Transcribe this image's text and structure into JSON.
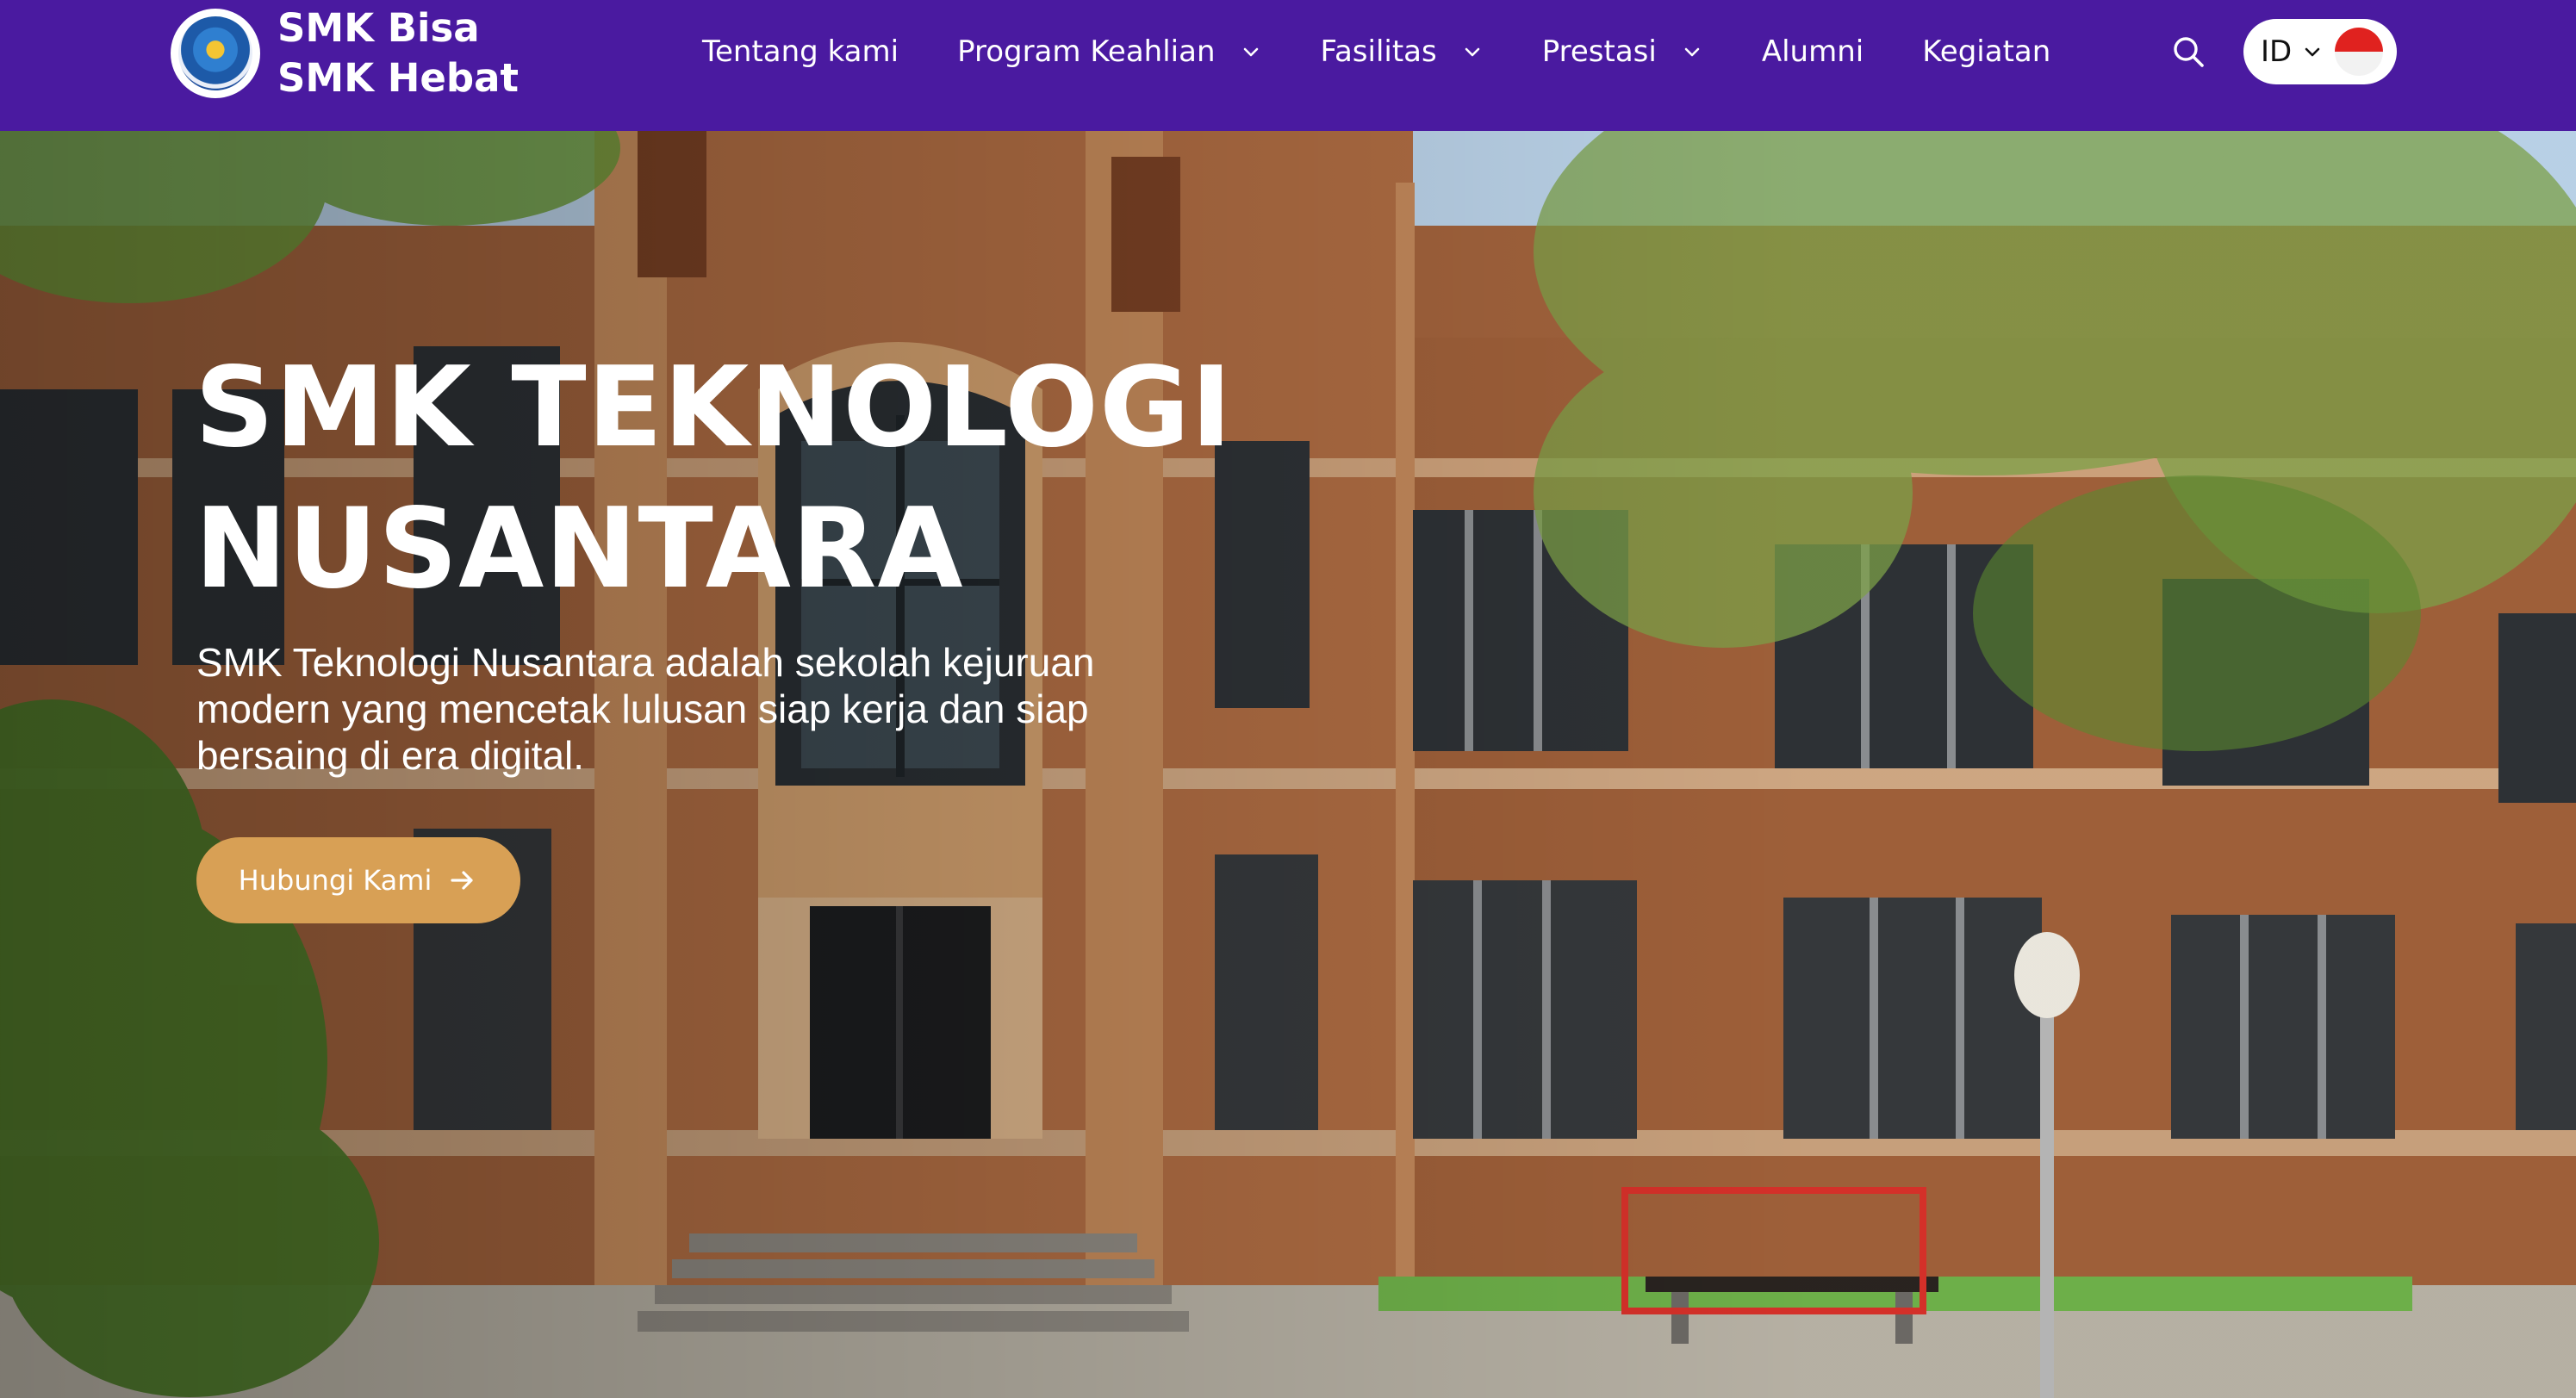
{
  "brand": {
    "line1": "SMK Bisa",
    "line2": "SMK Hebat",
    "logo_icon": "tut-wuri-handayani-logo-icon"
  },
  "nav": {
    "items": [
      {
        "label": "Tentang kami",
        "dropdown": false
      },
      {
        "label": "Program Keahlian",
        "dropdown": true
      },
      {
        "label": "Fasilitas",
        "dropdown": true
      },
      {
        "label": "Prestasi",
        "dropdown": true
      },
      {
        "label": "Alumni",
        "dropdown": false
      },
      {
        "label": "Kegiatan",
        "dropdown": false
      }
    ],
    "search_icon": "search-icon",
    "language": {
      "code": "ID",
      "flag_icon": "indonesia-flag-icon"
    }
  },
  "hero": {
    "title_line1": "SMK TEKNOLOGI",
    "title_line2": "NUSANTARA",
    "description_line1": "SMK Teknologi Nusantara adalah sekolah kejuruan",
    "description_line2": "modern yang mencetak lulusan siap kerja dan siap",
    "description_line3": "bersaing di era digital.",
    "cta_label": "Hubungi Kami",
    "background": "brick-school-building-photo"
  },
  "colors": {
    "navbar": "#4a1aa0",
    "cta": "#d8a055",
    "text": "#ffffff"
  }
}
